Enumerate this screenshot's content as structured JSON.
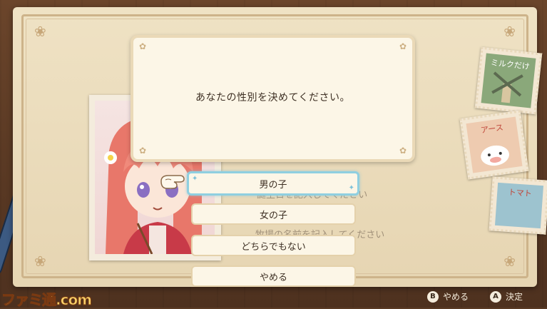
{
  "dialog": {
    "message": "あなたの性別を決めてください。"
  },
  "options": [
    {
      "label": "男の子",
      "selected": true
    },
    {
      "label": "女の子",
      "selected": false
    },
    {
      "label": "どちらでもない",
      "selected": false
    },
    {
      "label": "やめる",
      "selected": false
    }
  ],
  "background_lines": {
    "line1": "誕生日を記入してください",
    "line2": "牧場の名前を記入してください"
  },
  "controls": {
    "b": {
      "key": "B",
      "label": "やめる"
    },
    "a": {
      "key": "A",
      "label": "決定"
    }
  },
  "watermark": "ファミ通.com",
  "stamps": {
    "top": "ミルクだけ",
    "mid": "アース",
    "bottom": "トマト"
  },
  "colors": {
    "dialog_bg": "#fcf6e7",
    "selected_border": "#8fcfe0",
    "paper": "#efe2c4",
    "desk": "#5b3a24"
  }
}
